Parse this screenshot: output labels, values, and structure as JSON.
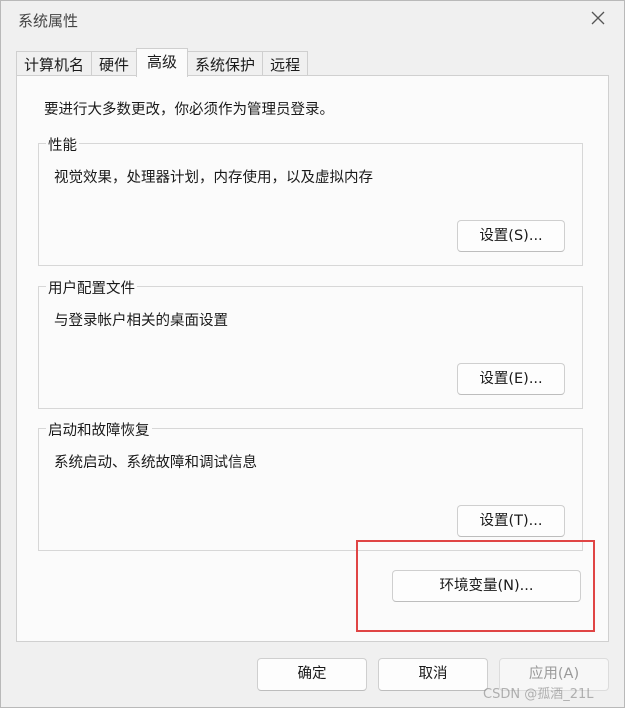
{
  "window": {
    "title": "系统属性",
    "close_icon": "close-icon"
  },
  "tabs": [
    {
      "label": "计算机名",
      "active": false
    },
    {
      "label": "硬件",
      "active": false
    },
    {
      "label": "高级",
      "active": true
    },
    {
      "label": "系统保护",
      "active": false
    },
    {
      "label": "远程",
      "active": false
    }
  ],
  "panel": {
    "notice": "要进行大多数更改，你必须作为管理员登录。",
    "groups": [
      {
        "label": "性能",
        "description": "视觉效果，处理器计划，内存使用，以及虚拟内存",
        "button": "设置(S)..."
      },
      {
        "label": "用户配置文件",
        "description": "与登录帐户相关的桌面设置",
        "button": "设置(E)..."
      },
      {
        "label": "启动和故障恢复",
        "description": "系统启动、系统故障和调试信息",
        "button": "设置(T)..."
      }
    ],
    "env_button": "环境变量(N)..."
  },
  "footer": {
    "ok": "确定",
    "cancel": "取消",
    "apply": "应用(A)"
  },
  "watermark": "CSDN @孤酒_21L",
  "colors": {
    "highlight": "#e04545",
    "window_bg": "#f0f0f0",
    "panel_bg": "#fbfbfb"
  }
}
